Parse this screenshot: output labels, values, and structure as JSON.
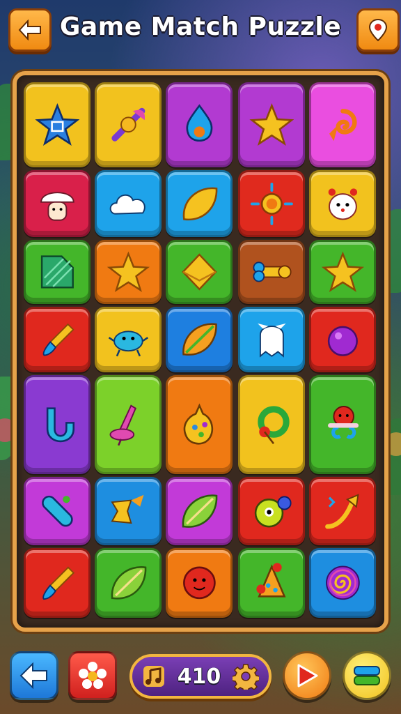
{
  "header": {
    "title": "Game Match Puzzle",
    "back_icon": "back-arrow-icon",
    "map_icon": "map-pin-icon"
  },
  "board": {
    "rows": [
      [
        {
          "name": "blue-star-maze",
          "color": "#f2c21e",
          "icon": "blue-star"
        },
        {
          "name": "pink-candy-wand",
          "color": "#f2c21e",
          "icon": "candy-wand"
        },
        {
          "name": "blue-flame-drop",
          "color": "#b23ad1",
          "icon": "flame-drop"
        },
        {
          "name": "yellow-star",
          "color": "#b23ad1",
          "icon": "star"
        },
        {
          "name": "orange-swirl-feather",
          "color": "#ea4ee0",
          "icon": "swirl"
        }
      ],
      [
        {
          "name": "white-mushroom",
          "color": "#d9204a",
          "icon": "mushroom"
        },
        {
          "name": "white-cloud",
          "color": "#1ea3ea",
          "icon": "cloud"
        },
        {
          "name": "yellow-leaf",
          "color": "#1ea3ea",
          "icon": "leaf"
        },
        {
          "name": "orange-sun",
          "color": "#e02a1e",
          "icon": "sun"
        },
        {
          "name": "white-critter",
          "color": "#f2c21e",
          "icon": "critter"
        }
      ],
      [
        {
          "name": "green-striped-block",
          "color": "#44b62a",
          "icon": "striped"
        },
        {
          "name": "gold-star",
          "color": "#f07a12",
          "icon": "star"
        },
        {
          "name": "gold-diamond",
          "color": "#44b62a",
          "icon": "diamond"
        },
        {
          "name": "bone-key",
          "color": "#b0521e",
          "icon": "bone"
        },
        {
          "name": "gold-star-green",
          "color": "#44b62a",
          "icon": "star"
        }
      ],
      [
        {
          "name": "blue-brush",
          "color": "#e0281e",
          "icon": "brush"
        },
        {
          "name": "blue-crab",
          "color": "#f2c21e",
          "icon": "crab"
        },
        {
          "name": "orange-seed",
          "color": "#1e7fe0",
          "icon": "seed"
        },
        {
          "name": "white-ghost",
          "color": "#1ea3ea",
          "icon": "ghost"
        },
        {
          "name": "purple-orb",
          "color": "#e0281e",
          "icon": "orb"
        }
      ],
      [
        {
          "name": "blue-trumpet",
          "color": "#8a3ad1",
          "icon": "trumpet"
        },
        {
          "name": "pink-spinning-top",
          "color": "#7cd12a",
          "icon": "spinning-top"
        },
        {
          "name": "spotted-egg-bottle",
          "color": "#f07a12",
          "icon": "egg"
        },
        {
          "name": "leaf-wreath",
          "color": "#f2c21e",
          "icon": "wreath"
        },
        {
          "name": "red-balloon-creature",
          "color": "#44b62a",
          "icon": "balloon"
        }
      ],
      [
        {
          "name": "blue-bar-capsule",
          "color": "#c23ad8",
          "icon": "capsule"
        },
        {
          "name": "gold-arrow-ribbon",
          "color": "#1e8ee0",
          "icon": "ribbon"
        },
        {
          "name": "green-leaf-pod",
          "color": "#c23ad8",
          "icon": "leaf-pod"
        },
        {
          "name": "yellow-blob-monster",
          "color": "#e0281e",
          "icon": "blob"
        },
        {
          "name": "gold-curved-arrow",
          "color": "#e0281e",
          "icon": "arrow"
        }
      ],
      [
        {
          "name": "blue-brush-red",
          "color": "#e0281e",
          "icon": "brush"
        },
        {
          "name": "orange-leaf-pod",
          "color": "#44b62a",
          "icon": "leaf-pod"
        },
        {
          "name": "red-smile-ball",
          "color": "#f07a12",
          "icon": "smile"
        },
        {
          "name": "orange-bell-creature",
          "color": "#44b62a",
          "icon": "bell"
        },
        {
          "name": "rainbow-swirl-candy",
          "color": "#1e8ee0",
          "icon": "swirl-candy"
        }
      ]
    ]
  },
  "footer": {
    "score": "410",
    "music_icon": "music-note-icon",
    "settings_icon": "gear-icon",
    "home_icon": "home-arrow-icon",
    "flower_icon": "flower-icon",
    "play_icon": "play-icon",
    "menu_icon": "menu-card-icon"
  }
}
